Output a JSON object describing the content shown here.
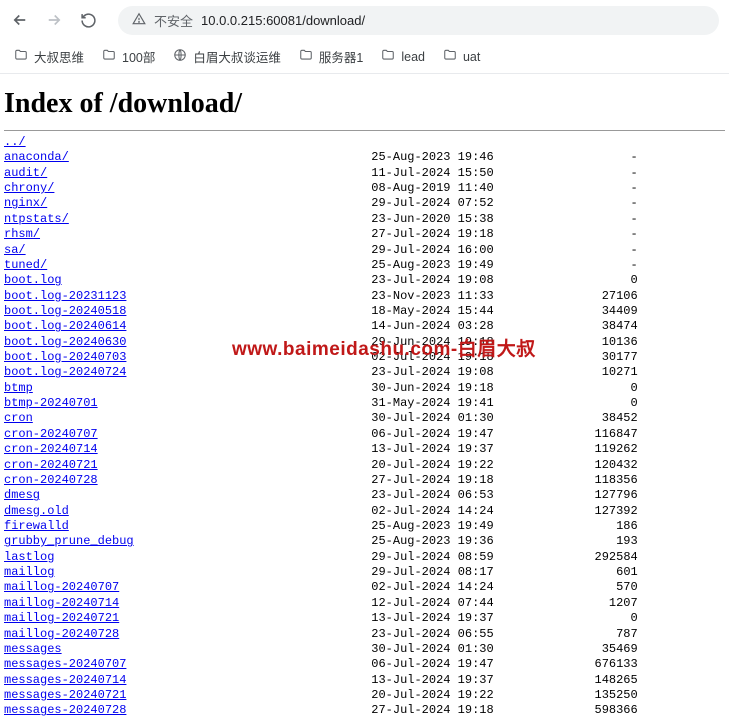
{
  "browser": {
    "security_label": "不安全",
    "url": "10.0.0.215:60081/download/"
  },
  "bookmarks": [
    {
      "icon": "folder",
      "label": "大叔思维"
    },
    {
      "icon": "folder",
      "label": "100部"
    },
    {
      "icon": "globe",
      "label": "白眉大叔谈运维"
    },
    {
      "icon": "folder",
      "label": "服务器1"
    },
    {
      "icon": "folder",
      "label": "lead"
    },
    {
      "icon": "folder",
      "label": "uat"
    }
  ],
  "page": {
    "title": "Index of /download/",
    "parent_dir": "../"
  },
  "files": [
    {
      "name": "anaconda/",
      "date": "25-Aug-2023 19:46",
      "size": "-"
    },
    {
      "name": "audit/",
      "date": "11-Jul-2024 15:50",
      "size": "-"
    },
    {
      "name": "chrony/",
      "date": "08-Aug-2019 11:40",
      "size": "-"
    },
    {
      "name": "nginx/",
      "date": "29-Jul-2024 07:52",
      "size": "-"
    },
    {
      "name": "ntpstats/",
      "date": "23-Jun-2020 15:38",
      "size": "-"
    },
    {
      "name": "rhsm/",
      "date": "27-Jul-2024 19:18",
      "size": "-"
    },
    {
      "name": "sa/",
      "date": "29-Jul-2024 16:00",
      "size": "-"
    },
    {
      "name": "tuned/",
      "date": "25-Aug-2023 19:49",
      "size": "-"
    },
    {
      "name": "boot.log",
      "date": "23-Jul-2024 19:08",
      "size": "0"
    },
    {
      "name": "boot.log-20231123",
      "date": "23-Nov-2023 11:33",
      "size": "27106"
    },
    {
      "name": "boot.log-20240518",
      "date": "18-May-2024 15:44",
      "size": "34409"
    },
    {
      "name": "boot.log-20240614",
      "date": "14-Jun-2024 03:28",
      "size": "38474"
    },
    {
      "name": "boot.log-20240630",
      "date": "29-Jun-2024 19:18",
      "size": "10136"
    },
    {
      "name": "boot.log-20240703",
      "date": "02-Jul-2024 19:18",
      "size": "30177"
    },
    {
      "name": "boot.log-20240724",
      "date": "23-Jul-2024 19:08",
      "size": "10271"
    },
    {
      "name": "btmp",
      "date": "30-Jun-2024 19:18",
      "size": "0"
    },
    {
      "name": "btmp-20240701",
      "date": "31-May-2024 19:41",
      "size": "0"
    },
    {
      "name": "cron",
      "date": "30-Jul-2024 01:30",
      "size": "38452"
    },
    {
      "name": "cron-20240707",
      "date": "06-Jul-2024 19:47",
      "size": "116847"
    },
    {
      "name": "cron-20240714",
      "date": "13-Jul-2024 19:37",
      "size": "119262"
    },
    {
      "name": "cron-20240721",
      "date": "20-Jul-2024 19:22",
      "size": "120432"
    },
    {
      "name": "cron-20240728",
      "date": "27-Jul-2024 19:18",
      "size": "118356"
    },
    {
      "name": "dmesg",
      "date": "23-Jul-2024 06:53",
      "size": "127796"
    },
    {
      "name": "dmesg.old",
      "date": "02-Jul-2024 14:24",
      "size": "127392"
    },
    {
      "name": "firewalld",
      "date": "25-Aug-2023 19:49",
      "size": "186"
    },
    {
      "name": "grubby_prune_debug",
      "date": "25-Aug-2023 19:36",
      "size": "193"
    },
    {
      "name": "lastlog",
      "date": "29-Jul-2024 08:59",
      "size": "292584"
    },
    {
      "name": "maillog",
      "date": "29-Jul-2024 08:17",
      "size": "601"
    },
    {
      "name": "maillog-20240707",
      "date": "02-Jul-2024 14:24",
      "size": "570"
    },
    {
      "name": "maillog-20240714",
      "date": "12-Jul-2024 07:44",
      "size": "1207"
    },
    {
      "name": "maillog-20240721",
      "date": "13-Jul-2024 19:37",
      "size": "0"
    },
    {
      "name": "maillog-20240728",
      "date": "23-Jul-2024 06:55",
      "size": "787"
    },
    {
      "name": "messages",
      "date": "30-Jul-2024 01:30",
      "size": "35469"
    },
    {
      "name": "messages-20240707",
      "date": "06-Jul-2024 19:47",
      "size": "676133"
    },
    {
      "name": "messages-20240714",
      "date": "13-Jul-2024 19:37",
      "size": "148265"
    },
    {
      "name": "messages-20240721",
      "date": "20-Jul-2024 19:22",
      "size": "135250"
    },
    {
      "name": "messages-20240728",
      "date": "27-Jul-2024 19:18",
      "size": "598366"
    }
  ],
  "watermark": "www.baimeidashu.com-白眉大叔"
}
